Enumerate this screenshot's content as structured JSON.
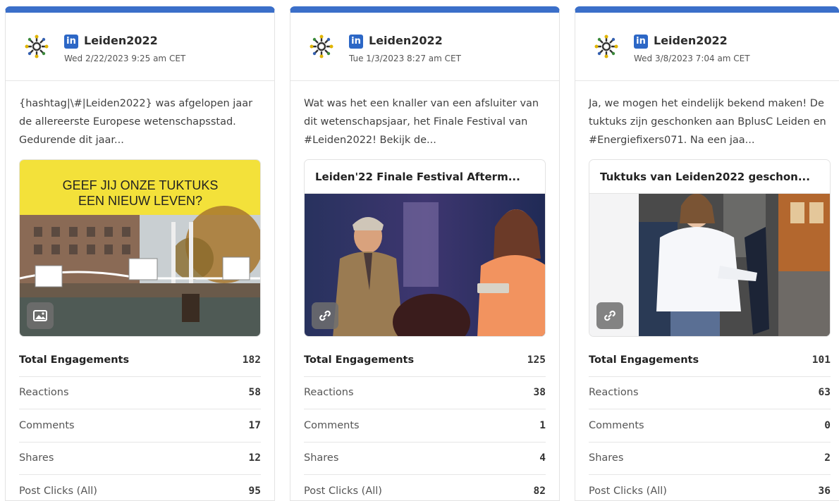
{
  "posts": [
    {
      "account": "Leiden2022",
      "network_icon": "linkedin-icon",
      "network_icon_text": "in",
      "date": "Wed 2/22/2023 9:25 am CET",
      "text": "{hashtag|\\#|Leiden2022} was afgelopen jaar de allereerste Europese wetenschapsstad. Gedurende dit jaar...",
      "media_type": "image",
      "media_caption": "GEEF JIJ ONZE TUKTUKS EEN NIEUW LEVEN?",
      "link_title": "",
      "metrics": [
        {
          "label": "Total Engagements",
          "value": "182"
        },
        {
          "label": "Reactions",
          "value": "58"
        },
        {
          "label": "Comments",
          "value": "17"
        },
        {
          "label": "Shares",
          "value": "12"
        },
        {
          "label": "Post Clicks (All)",
          "value": "95"
        }
      ]
    },
    {
      "account": "Leiden2022",
      "network_icon": "linkedin-icon",
      "network_icon_text": "in",
      "date": "Tue 1/3/2023 8:27 am CET",
      "text": "Wat was het een knaller van een afsluiter van dit wetenschapsjaar, het Finale Festival van #Leiden2022! Bekijk de...",
      "media_type": "link",
      "link_title": "Leiden'22 Finale Festival Afterm...",
      "metrics": [
        {
          "label": "Total Engagements",
          "value": "125"
        },
        {
          "label": "Reactions",
          "value": "38"
        },
        {
          "label": "Comments",
          "value": "1"
        },
        {
          "label": "Shares",
          "value": "4"
        },
        {
          "label": "Post Clicks (All)",
          "value": "82"
        }
      ]
    },
    {
      "account": "Leiden2022",
      "network_icon": "linkedin-icon",
      "network_icon_text": "in",
      "date": "Wed 3/8/2023 7:04 am CET",
      "text": "Ja, we mogen het eindelijk bekend maken! De tuktuks zijn geschonken aan BplusC Leiden en #Energiefixers071. Na een jaa...",
      "media_type": "link",
      "link_title": "Tuktuks van Leiden2022 geschon...",
      "metrics": [
        {
          "label": "Total Engagements",
          "value": "101"
        },
        {
          "label": "Reactions",
          "value": "63"
        },
        {
          "label": "Comments",
          "value": "0"
        },
        {
          "label": "Shares",
          "value": "2"
        },
        {
          "label": "Post Clicks (All)",
          "value": "36"
        }
      ]
    }
  ],
  "colors": {
    "accent": "#3b6fc9",
    "linkedin": "#2c67c6",
    "banner_yellow": "#f3e13a"
  }
}
